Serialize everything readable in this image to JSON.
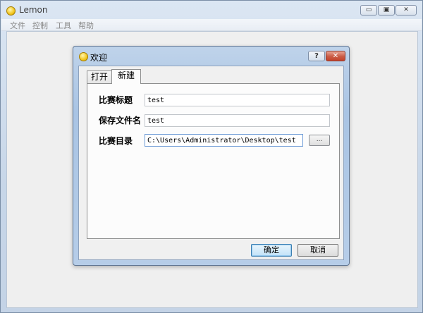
{
  "app": {
    "title": "Lemon",
    "window_controls": {
      "minimize": "▭",
      "maximize": "▣",
      "close": "✕"
    }
  },
  "menu": [
    "文件",
    "控制",
    "工具",
    "帮助"
  ],
  "dialog": {
    "title": "欢迎",
    "help_label": "?",
    "close_label": "✕",
    "tabs": [
      {
        "label": "打开",
        "active": false
      },
      {
        "label": "新建",
        "active": true
      }
    ],
    "fields": {
      "contest_title": {
        "label": "比赛标题",
        "value": "test"
      },
      "save_filename": {
        "label": "保存文件名",
        "value": "test"
      },
      "contest_dir": {
        "label": "比赛目录",
        "value": "C:\\Users\\Administrator\\Desktop\\test"
      }
    },
    "browse_label": "...",
    "ok_label": "确定",
    "cancel_label": "取消"
  },
  "icons": [
    "app-lemon-icon",
    "dialog-lemon-icon"
  ]
}
